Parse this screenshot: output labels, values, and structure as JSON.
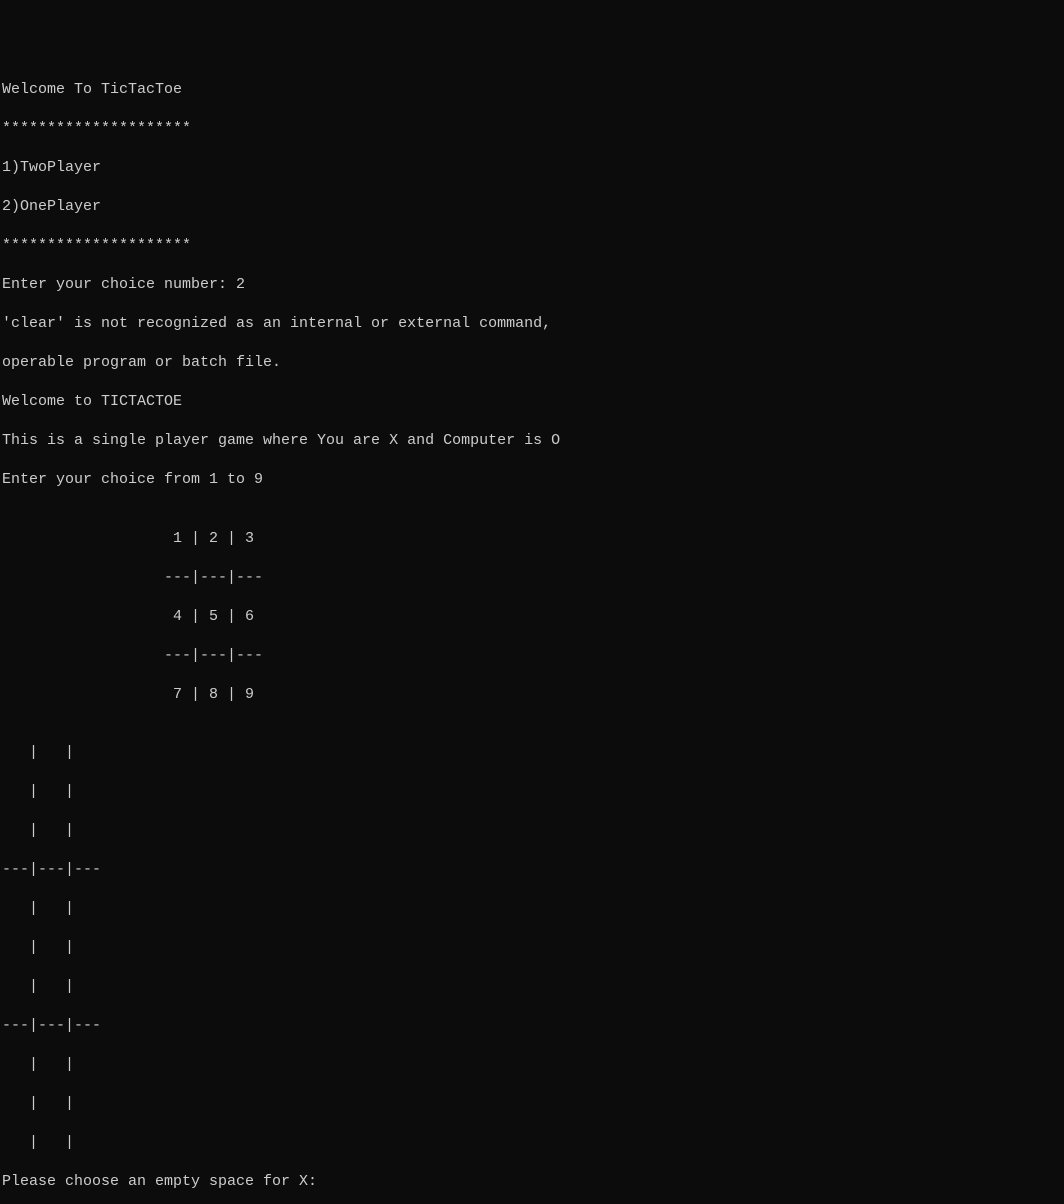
{
  "terminal": {
    "welcome": "Welcome To TicTacToe",
    "stars1": "*********************",
    "option1": "1)TwoPlayer",
    "option2": "2)OnePlayer",
    "stars2": "*********************",
    "prompt_choice": "Enter your choice number: 2",
    "error_line1": "'clear' is not recognized as an internal or external command,",
    "error_line2": "operable program or batch file.",
    "welcome2": "Welcome to TICTACTOE",
    "description": "This is a single player game where You are X and Computer is O",
    "instruction": "Enter your choice from 1 to 9",
    "blank1": "",
    "board_ref1": "                   1 | 2 | 3",
    "board_ref2": "                  ---|---|---",
    "board_ref3": "                   4 | 5 | 6",
    "board_ref4": "                  ---|---|---",
    "board_ref5": "                   7 | 8 | 9",
    "blank2": "",
    "game_row1": "   |   | ",
    "game_row2": "   |   | ",
    "game_row3": "   |   | ",
    "game_div1": "---|---|---",
    "game_row4": "   |   | ",
    "game_row5": "   |   | ",
    "game_row6": "   |   | ",
    "game_div2": "---|---|---",
    "game_row7": "   |   | ",
    "game_row8": "   |   | ",
    "game_row9": "   |   | ",
    "prompt_move": "Please choose an empty space for X: "
  }
}
